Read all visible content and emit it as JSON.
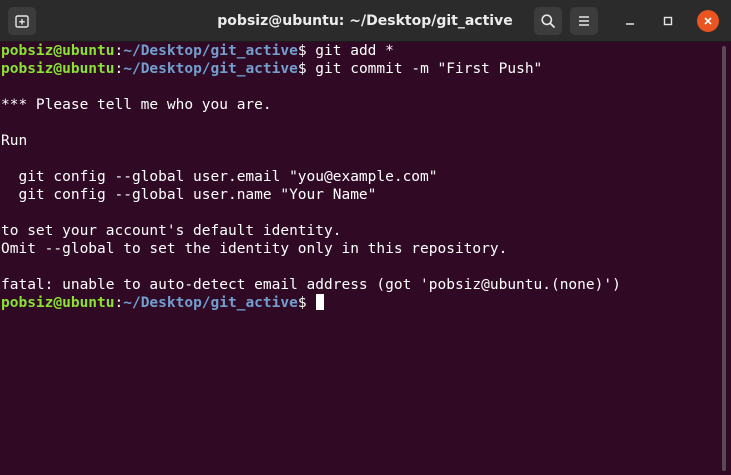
{
  "window": {
    "title": "pobsiz@ubuntu: ~/Desktop/git_active"
  },
  "icons": {
    "new_tab": "new-tab-icon",
    "search": "search-icon",
    "menu": "hamburger-menu-icon",
    "minimize": "minimize-icon",
    "maximize": "maximize-icon",
    "close": "close-icon"
  },
  "colors": {
    "background": "#300a24",
    "prompt_user": "#8ae234",
    "prompt_path": "#729fcf",
    "text": "#ffffff",
    "close_button": "#e95420"
  },
  "terminal": {
    "prompt": {
      "user": "pobsiz@ubuntu",
      "sep": ":",
      "path": "~/Desktop/git_active",
      "symbol": "$"
    },
    "commands": [
      " git add *",
      " git commit -m \"First Push\""
    ],
    "output": [
      "",
      "*** Please tell me who you are.",
      "",
      "Run",
      "",
      "  git config --global user.email \"you@example.com\"",
      "  git config --global user.name \"Your Name\"",
      "",
      "to set your account's default identity.",
      "Omit --global to set the identity only in this repository.",
      "",
      "fatal: unable to auto-detect email address (got 'pobsiz@ubuntu.(none)')"
    ]
  }
}
